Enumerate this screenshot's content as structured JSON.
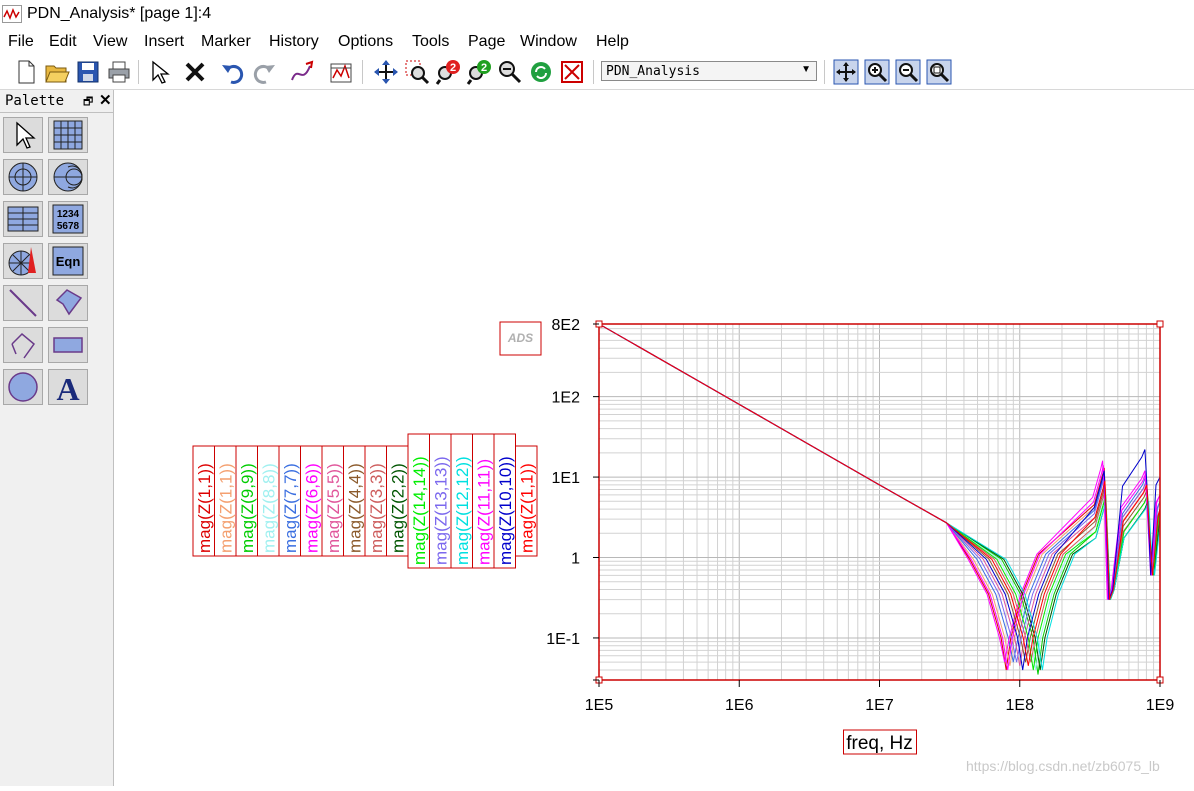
{
  "window": {
    "title": "PDN_Analysis* [page 1]:4"
  },
  "menubar": [
    "File",
    "Edit",
    "View",
    "Insert",
    "Marker",
    "History",
    "Options",
    "Tools",
    "Page",
    "Window",
    "Help"
  ],
  "toolbar": {
    "page_select": "PDN_Analysis",
    "icons": [
      "new-icon",
      "open-icon",
      "save-icon",
      "print-icon",
      "select-icon",
      "delete-icon",
      "undo-icon",
      "redo-icon",
      "insert-trace-icon",
      "plot-options-icon",
      "pan-icon",
      "zoom-area-icon",
      "zoom-in-x2-icon",
      "zoom-out-x2-icon",
      "zoom-out-icon",
      "refresh-icon",
      "clear-icon",
      "fit-view-icon",
      "view-zoom-in-icon",
      "view-zoom-out-icon",
      "view-zoom-fit-icon"
    ]
  },
  "palette": {
    "title": "Palette",
    "tools": [
      "select-tool",
      "rectangular-plot-tool",
      "polar-plot-tool",
      "smith-chart-tool",
      "list-tool",
      "stack-tool",
      "antenna-plot-tool",
      "equation-tool",
      "line-tool",
      "polygon-tool",
      "polyline-tool",
      "rectangle-tool",
      "circle-tool",
      "text-tool"
    ],
    "equation_label": "Eqn",
    "stack_label_1": "1234",
    "stack_label_2": "5678",
    "text_label": "A"
  },
  "plot": {
    "ads_badge": "ADS",
    "legend": [
      {
        "text": "mag(Z(1,1))",
        "color": "#dd0000"
      },
      {
        "text": "mag(Z(1,1))",
        "color": "#f4a070"
      },
      {
        "text": "mag(Z(9,9))",
        "color": "#00cc00"
      },
      {
        "text": "mag(Z(8,8))",
        "color": "#a0f0f0"
      },
      {
        "text": "mag(Z(7,7))",
        "color": "#3b6fe0"
      },
      {
        "text": "mag(Z(6,6))",
        "color": "#ff00ff"
      },
      {
        "text": "mag(Z(5,5))",
        "color": "#e0559a"
      },
      {
        "text": "mag(Z(4,4))",
        "color": "#8b5a2b"
      },
      {
        "text": "mag(Z(3,3))",
        "color": "#cd5c5c"
      },
      {
        "text": "mag(Z(2,2))",
        "color": "#005500"
      },
      {
        "text": "mag(Z(14,14))",
        "color": "#00ee00"
      },
      {
        "text": "mag(Z(13,13))",
        "color": "#7b68ee"
      },
      {
        "text": "mag(Z(12,12))",
        "color": "#00e0e0"
      },
      {
        "text": "mag(Z(11,11))",
        "color": "#ff00ff"
      },
      {
        "text": "mag(Z(10,10))",
        "color": "#0000cc"
      },
      {
        "text": "mag(Z(1,1))",
        "color": "#ff0000"
      }
    ]
  },
  "chart_data": {
    "type": "line",
    "xlabel": "freq, Hz",
    "ylabel": "",
    "x_scale": "log",
    "y_scale": "log",
    "xlim": [
      100000,
      1000000000
    ],
    "ylim": [
      0.03,
      800
    ],
    "x_ticks": [
      "1E5",
      "1E6",
      "1E7",
      "1E8",
      "1E9"
    ],
    "y_ticks": [
      "8E2",
      "1E2",
      "1E1",
      "1",
      "1E-1"
    ],
    "grid": true,
    "series_common": {
      "x": [
        100000,
        1000000,
        10000000,
        30000000
      ],
      "values": [
        800,
        80,
        8,
        2.7
      ]
    },
    "series": [
      {
        "color": "#dd0000",
        "min_freq": 80000000,
        "min_val": 0.04,
        "peak1_freq": 400000000,
        "peak1_val": 13,
        "peak2_freq": 800000000,
        "peak2_val": 9,
        "end_val": 2.5
      },
      {
        "color": "#f4a070",
        "min_freq": 85000000,
        "min_val": 0.045,
        "peak1_freq": 400000000,
        "peak1_val": 12,
        "peak2_freq": 800000000,
        "peak2_val": 8,
        "end_val": 3
      },
      {
        "color": "#00cc00",
        "min_freq": 135000000,
        "min_val": 0.035,
        "peak1_freq": 410000000,
        "peak1_val": 6,
        "peak2_freq": 820000000,
        "peak2_val": 5,
        "end_val": 3.5
      },
      {
        "color": "#a0f0f0",
        "min_freq": 130000000,
        "min_val": 0.04,
        "peak1_freq": 410000000,
        "peak1_val": 7,
        "peak2_freq": 820000000,
        "peak2_val": 6,
        "end_val": 4
      },
      {
        "color": "#3b6fe0",
        "min_freq": 90000000,
        "min_val": 0.05,
        "peak1_freq": 400000000,
        "peak1_val": 11,
        "peak2_freq": 790000000,
        "peak2_val": 10,
        "end_val": 5
      },
      {
        "color": "#ff00ff",
        "min_freq": 78000000,
        "min_val": 0.05,
        "peak1_freq": 390000000,
        "peak1_val": 16,
        "peak2_freq": 780000000,
        "peak2_val": 12,
        "end_val": 6
      },
      {
        "color": "#e0559a",
        "min_freq": 100000000,
        "min_val": 0.045,
        "peak1_freq": 405000000,
        "peak1_val": 9,
        "peak2_freq": 800000000,
        "peak2_val": 8,
        "end_val": 4
      },
      {
        "color": "#8b5a2b",
        "min_freq": 110000000,
        "min_val": 0.05,
        "peak1_freq": 405000000,
        "peak1_val": 8,
        "peak2_freq": 810000000,
        "peak2_val": 7,
        "end_val": 4
      },
      {
        "color": "#cd5c5c",
        "min_freq": 120000000,
        "min_val": 0.05,
        "peak1_freq": 405000000,
        "peak1_val": 7,
        "peak2_freq": 815000000,
        "peak2_val": 6,
        "end_val": 3.5
      },
      {
        "color": "#005500",
        "min_freq": 140000000,
        "min_val": 0.04,
        "peak1_freq": 410000000,
        "peak1_val": 5,
        "peak2_freq": 820000000,
        "peak2_val": 5,
        "end_val": 3
      },
      {
        "color": "#00ee00",
        "min_freq": 125000000,
        "min_val": 0.04,
        "peak1_freq": 410000000,
        "peak1_val": 6,
        "peak2_freq": 815000000,
        "peak2_val": 6,
        "end_val": 4
      },
      {
        "color": "#7b68ee",
        "min_freq": 95000000,
        "min_val": 0.05,
        "peak1_freq": 400000000,
        "peak1_val": 10,
        "peak2_freq": 800000000,
        "peak2_val": 9,
        "end_val": 5
      },
      {
        "color": "#00e0e0",
        "min_freq": 145000000,
        "min_val": 0.04,
        "peak1_freq": 410000000,
        "peak1_val": 5,
        "peak2_freq": 830000000,
        "peak2_val": 5,
        "end_val": 3
      },
      {
        "color": "#ff00ff",
        "min_freq": 82000000,
        "min_val": 0.04,
        "peak1_freq": 395000000,
        "peak1_val": 14,
        "peak2_freq": 790000000,
        "peak2_val": 11,
        "end_val": 6
      },
      {
        "color": "#0000cc",
        "min_freq": 105000000,
        "min_val": 0.04,
        "peak1_freq": 400000000,
        "peak1_val": 12,
        "peak2_freq": 780000000,
        "peak2_val": 22,
        "end_val": 10
      },
      {
        "color": "#ff0000",
        "min_freq": 115000000,
        "min_val": 0.045,
        "peak1_freq": 405000000,
        "peak1_val": 9,
        "peak2_freq": 805000000,
        "peak2_val": 8,
        "end_val": 4
      }
    ]
  },
  "watermark": "https://blog.csdn.net/zb6075_lb"
}
